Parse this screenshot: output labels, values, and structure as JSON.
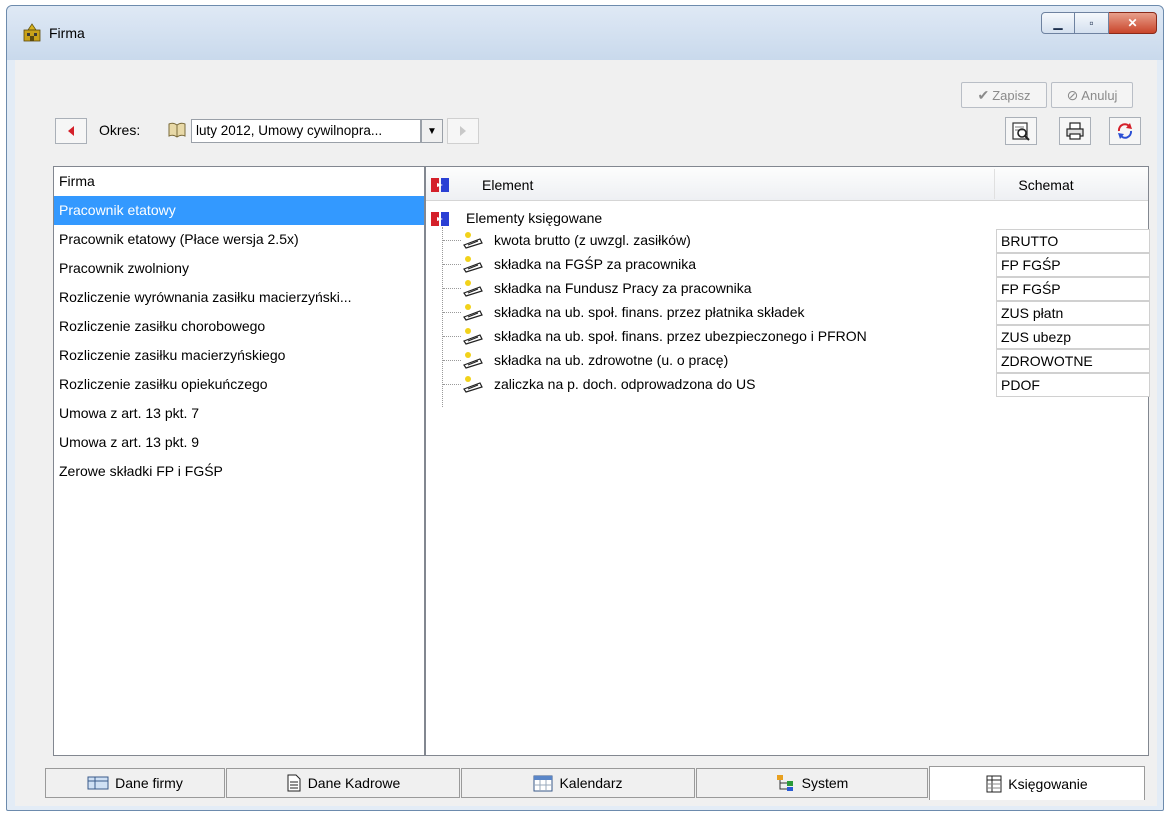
{
  "window": {
    "title": "Firma",
    "caption_buttons": {
      "minimize": "▁",
      "maximize": "▫",
      "close": "✕"
    }
  },
  "toolbar": {
    "save_label": "Zapisz",
    "cancel_label": "Anuluj",
    "okres_label": "Okres:",
    "okres_value": "luty 2012, Umowy cywilnopra...",
    "prev_icon": "prev-arrow-icon",
    "next_icon": "next-arrow-icon",
    "right_icons": [
      "preview-icon",
      "print-icon",
      "refresh-icon"
    ]
  },
  "left_list": {
    "items": [
      "Firma",
      "Pracownik etatowy",
      "Pracownik etatowy (Płace wersja 2.5x)",
      "Pracownik zwolniony",
      "Rozliczenie wyrównania zasiłku macierzyński...",
      "Rozliczenie zasiłku chorobowego",
      "Rozliczenie zasiłku macierzyńskiego",
      "Rozliczenie zasiłku opiekuńczego",
      "Umowa z art. 13 pkt. 7",
      "Umowa z art. 13 pkt. 9",
      "Zerowe składki FP i FGŚP"
    ],
    "selected_index": 1
  },
  "grid": {
    "header_element": "Element",
    "header_schemat": "Schemat",
    "root_label": "Elementy księgowane",
    "rows": [
      {
        "label": "kwota brutto (z uwzgl. zasiłków)",
        "schemat": "BRUTTO"
      },
      {
        "label": "składka na FGŚP za pracownika",
        "schemat": "FP FGŚP"
      },
      {
        "label": "składka na Fundusz Pracy za pracownika",
        "schemat": "FP FGŚP"
      },
      {
        "label": "składka na ub. społ. finans. przez płatnika składek",
        "schemat": "ZUS płatn"
      },
      {
        "label": "składka na ub. społ. finans. przez ubezpieczonego i PFRON",
        "schemat": "ZUS ubezp"
      },
      {
        "label": "składka na ub. zdrowotne (u. o pracę)",
        "schemat": "ZDROWOTNE"
      },
      {
        "label": "zaliczka na p. doch. odprowadzona do US",
        "schemat": "PDOF"
      }
    ]
  },
  "tabs": [
    {
      "label": "Dane firmy",
      "icon": "company-data-icon"
    },
    {
      "label": "Dane Kadrowe",
      "icon": "document-icon"
    },
    {
      "label": "Kalendarz",
      "icon": "calendar-icon"
    },
    {
      "label": "System",
      "icon": "system-tree-icon"
    },
    {
      "label": "Księgowanie",
      "icon": "ledger-icon",
      "active": true
    }
  ],
  "colors": {
    "selection": "#3399ff",
    "titlebar": "#c9d9ec",
    "accent_red": "#d4202a"
  }
}
